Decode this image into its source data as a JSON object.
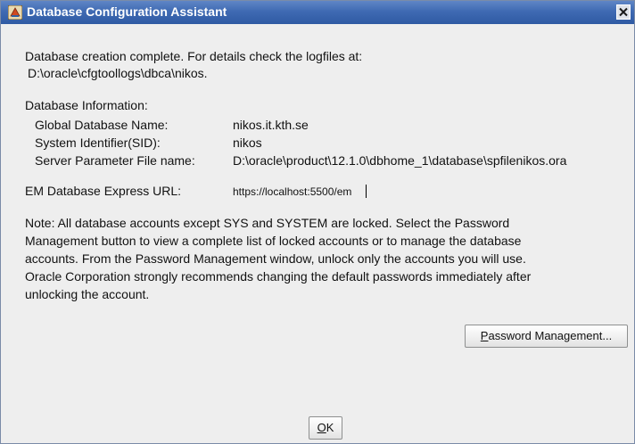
{
  "window": {
    "title": "Database Configuration Assistant",
    "icon": "oracle-dbca-icon",
    "close_icon": "close-icon"
  },
  "completion": {
    "line1": "Database creation complete. For details check the logfiles at:",
    "line2": "D:\\oracle\\cfgtoollogs\\dbca\\nikos."
  },
  "db_info": {
    "heading": "Database Information:",
    "global_name_label": "Global Database Name:",
    "global_name_value": "nikos.it.kth.se",
    "sid_label": "System Identifier(SID):",
    "sid_value": "nikos",
    "spfile_label": "Server Parameter File name:",
    "spfile_value": "D:\\oracle\\product\\12.1.0\\dbhome_1\\database\\spfilenikos.ora"
  },
  "em": {
    "label": "EM Database Express URL:",
    "url": "https://localhost:5500/em"
  },
  "note": {
    "lines": [
      "Note: All database accounts except SYS and SYSTEM are locked. Select the Password",
      "Management button to view a complete list of locked accounts or to manage the database",
      "accounts. From the Password Management window, unlock only the accounts you will use.",
      "Oracle Corporation strongly recommends changing the default passwords immediately after",
      "unlocking the account."
    ]
  },
  "buttons": {
    "password_management_mnemonic": "P",
    "password_management_rest": "assword Management...",
    "ok_mnemonic": "O",
    "ok_rest": "K"
  }
}
